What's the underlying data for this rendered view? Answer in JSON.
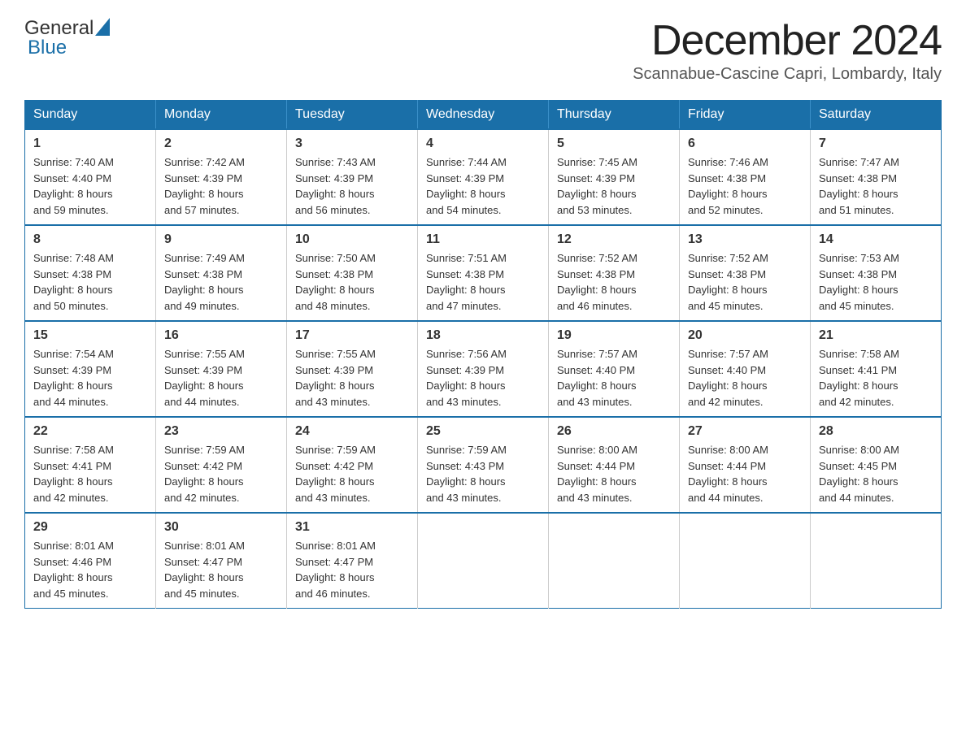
{
  "header": {
    "logo": {
      "text_general": "General",
      "text_blue": "Blue",
      "triangle": "▶"
    },
    "month_title": "December 2024",
    "location": "Scannabue-Cascine Capri, Lombardy, Italy"
  },
  "weekdays": [
    "Sunday",
    "Monday",
    "Tuesday",
    "Wednesday",
    "Thursday",
    "Friday",
    "Saturday"
  ],
  "weeks": [
    [
      {
        "day": "1",
        "sunrise": "7:40 AM",
        "sunset": "4:40 PM",
        "daylight": "8 hours and 59 minutes."
      },
      {
        "day": "2",
        "sunrise": "7:42 AM",
        "sunset": "4:39 PM",
        "daylight": "8 hours and 57 minutes."
      },
      {
        "day": "3",
        "sunrise": "7:43 AM",
        "sunset": "4:39 PM",
        "daylight": "8 hours and 56 minutes."
      },
      {
        "day": "4",
        "sunrise": "7:44 AM",
        "sunset": "4:39 PM",
        "daylight": "8 hours and 54 minutes."
      },
      {
        "day": "5",
        "sunrise": "7:45 AM",
        "sunset": "4:39 PM",
        "daylight": "8 hours and 53 minutes."
      },
      {
        "day": "6",
        "sunrise": "7:46 AM",
        "sunset": "4:38 PM",
        "daylight": "8 hours and 52 minutes."
      },
      {
        "day": "7",
        "sunrise": "7:47 AM",
        "sunset": "4:38 PM",
        "daylight": "8 hours and 51 minutes."
      }
    ],
    [
      {
        "day": "8",
        "sunrise": "7:48 AM",
        "sunset": "4:38 PM",
        "daylight": "8 hours and 50 minutes."
      },
      {
        "day": "9",
        "sunrise": "7:49 AM",
        "sunset": "4:38 PM",
        "daylight": "8 hours and 49 minutes."
      },
      {
        "day": "10",
        "sunrise": "7:50 AM",
        "sunset": "4:38 PM",
        "daylight": "8 hours and 48 minutes."
      },
      {
        "day": "11",
        "sunrise": "7:51 AM",
        "sunset": "4:38 PM",
        "daylight": "8 hours and 47 minutes."
      },
      {
        "day": "12",
        "sunrise": "7:52 AM",
        "sunset": "4:38 PM",
        "daylight": "8 hours and 46 minutes."
      },
      {
        "day": "13",
        "sunrise": "7:52 AM",
        "sunset": "4:38 PM",
        "daylight": "8 hours and 45 minutes."
      },
      {
        "day": "14",
        "sunrise": "7:53 AM",
        "sunset": "4:38 PM",
        "daylight": "8 hours and 45 minutes."
      }
    ],
    [
      {
        "day": "15",
        "sunrise": "7:54 AM",
        "sunset": "4:39 PM",
        "daylight": "8 hours and 44 minutes."
      },
      {
        "day": "16",
        "sunrise": "7:55 AM",
        "sunset": "4:39 PM",
        "daylight": "8 hours and 44 minutes."
      },
      {
        "day": "17",
        "sunrise": "7:55 AM",
        "sunset": "4:39 PM",
        "daylight": "8 hours and 43 minutes."
      },
      {
        "day": "18",
        "sunrise": "7:56 AM",
        "sunset": "4:39 PM",
        "daylight": "8 hours and 43 minutes."
      },
      {
        "day": "19",
        "sunrise": "7:57 AM",
        "sunset": "4:40 PM",
        "daylight": "8 hours and 43 minutes."
      },
      {
        "day": "20",
        "sunrise": "7:57 AM",
        "sunset": "4:40 PM",
        "daylight": "8 hours and 42 minutes."
      },
      {
        "day": "21",
        "sunrise": "7:58 AM",
        "sunset": "4:41 PM",
        "daylight": "8 hours and 42 minutes."
      }
    ],
    [
      {
        "day": "22",
        "sunrise": "7:58 AM",
        "sunset": "4:41 PM",
        "daylight": "8 hours and 42 minutes."
      },
      {
        "day": "23",
        "sunrise": "7:59 AM",
        "sunset": "4:42 PM",
        "daylight": "8 hours and 42 minutes."
      },
      {
        "day": "24",
        "sunrise": "7:59 AM",
        "sunset": "4:42 PM",
        "daylight": "8 hours and 43 minutes."
      },
      {
        "day": "25",
        "sunrise": "7:59 AM",
        "sunset": "4:43 PM",
        "daylight": "8 hours and 43 minutes."
      },
      {
        "day": "26",
        "sunrise": "8:00 AM",
        "sunset": "4:44 PM",
        "daylight": "8 hours and 43 minutes."
      },
      {
        "day": "27",
        "sunrise": "8:00 AM",
        "sunset": "4:44 PM",
        "daylight": "8 hours and 44 minutes."
      },
      {
        "day": "28",
        "sunrise": "8:00 AM",
        "sunset": "4:45 PM",
        "daylight": "8 hours and 44 minutes."
      }
    ],
    [
      {
        "day": "29",
        "sunrise": "8:01 AM",
        "sunset": "4:46 PM",
        "daylight": "8 hours and 45 minutes."
      },
      {
        "day": "30",
        "sunrise": "8:01 AM",
        "sunset": "4:47 PM",
        "daylight": "8 hours and 45 minutes."
      },
      {
        "day": "31",
        "sunrise": "8:01 AM",
        "sunset": "4:47 PM",
        "daylight": "8 hours and 46 minutes."
      },
      null,
      null,
      null,
      null
    ]
  ],
  "labels": {
    "sunrise": "Sunrise:",
    "sunset": "Sunset:",
    "daylight": "Daylight:"
  }
}
